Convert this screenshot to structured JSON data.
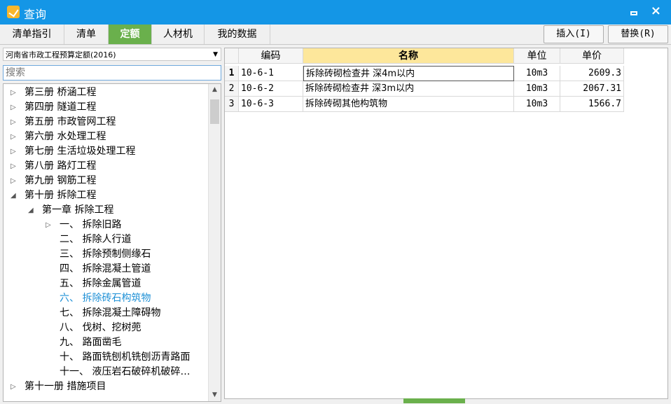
{
  "window": {
    "title": "查询",
    "close": "×"
  },
  "tabs": [
    {
      "label": "清单指引"
    },
    {
      "label": "清单"
    },
    {
      "label": "定额"
    },
    {
      "label": "人材机"
    },
    {
      "label": "我的数据"
    }
  ],
  "buttons": {
    "insert": "插入(I)",
    "replace": "替换(R)"
  },
  "quota_select": {
    "value": "河南省市政工程预算定额(2016)"
  },
  "search": {
    "placeholder": "搜索"
  },
  "tree": [
    {
      "label": "第三册 桥涵工程"
    },
    {
      "label": "第四册 隧道工程"
    },
    {
      "label": "第五册 市政管网工程"
    },
    {
      "label": "第六册 水处理工程"
    },
    {
      "label": "第七册 生活垃圾处理工程"
    },
    {
      "label": "第八册 路灯工程"
    },
    {
      "label": "第九册 钢筋工程"
    },
    {
      "label": "第十册 拆除工程"
    },
    {
      "label": "第一章 拆除工程"
    },
    {
      "label": "一、 拆除旧路"
    },
    {
      "label": "二、 拆除人行道"
    },
    {
      "label": "三、 拆除预制侧缘石"
    },
    {
      "label": "四、 拆除混凝土管道"
    },
    {
      "label": "五、 拆除金属管道"
    },
    {
      "label": "六、 拆除砖石构筑物"
    },
    {
      "label": "七、 拆除混凝土障碍物"
    },
    {
      "label": "八、 伐树、挖树蔸"
    },
    {
      "label": "九、 路面凿毛"
    },
    {
      "label": "十、 路面铣刨机铣刨沥青路面"
    },
    {
      "label": "十一、 液压岩石破碎机破碎…"
    },
    {
      "label": "第十一册 措施项目"
    }
  ],
  "table": {
    "headers": {
      "code": "编码",
      "name": "名称",
      "unit": "单位",
      "price": "单价"
    },
    "rows": [
      {
        "no": "1",
        "code": "10-6-1",
        "name": "拆除砖砌检查井 深4m以内",
        "unit": "10m3",
        "price": "2609.3"
      },
      {
        "no": "2",
        "code": "10-6-2",
        "name": "拆除砖砌检查井 深3m以内",
        "unit": "10m3",
        "price": "2067.31"
      },
      {
        "no": "3",
        "code": "10-6-3",
        "name": "拆除砖砌其他构筑物",
        "unit": "10m3",
        "price": "1566.7"
      }
    ]
  },
  "colors": {
    "titlebar": "#1496e6",
    "active_tab": "#6ab04c",
    "header_highlight": "#fde79b",
    "selected_tree": "#1e90d6"
  }
}
